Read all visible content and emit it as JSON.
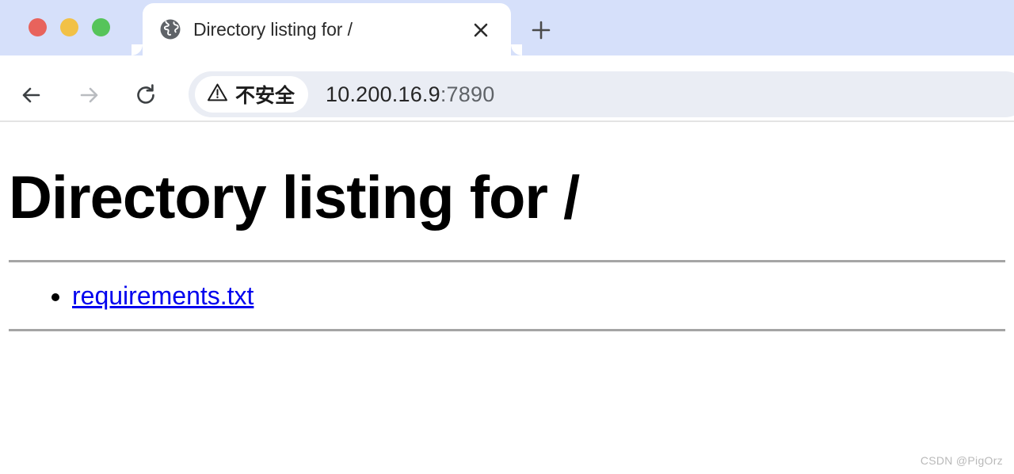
{
  "browser": {
    "window_controls": [
      {
        "name": "close",
        "color": "#e8635c"
      },
      {
        "name": "minimize",
        "color": "#f2c146"
      },
      {
        "name": "maximize",
        "color": "#56c45a"
      }
    ],
    "tabs": [
      {
        "title": "Directory listing for /",
        "favicon": "globe-icon",
        "active": true,
        "close_label": "×"
      }
    ],
    "new_tab_label": "+",
    "toolbar": {
      "back": {
        "icon": "arrow-left-icon",
        "enabled": true
      },
      "forward": {
        "icon": "arrow-right-icon",
        "enabled": false
      },
      "reload": {
        "icon": "reload-icon",
        "enabled": true
      },
      "omnibox": {
        "security_icon": "warning-triangle-icon",
        "security_label": "不安全",
        "url_host": "10.200.16.9",
        "url_port": ":7890",
        "url_full": "10.200.16.9:7890"
      }
    }
  },
  "page": {
    "heading": "Directory listing for /",
    "entries": [
      {
        "label": "requirements.txt"
      }
    ]
  },
  "watermark": "CSDN @PigOrz",
  "colors": {
    "tabstrip_bg": "#d6e0fa",
    "omnibox_bg": "#eaedf4",
    "link": "#0000ee",
    "rule": "#a5a5a5"
  }
}
